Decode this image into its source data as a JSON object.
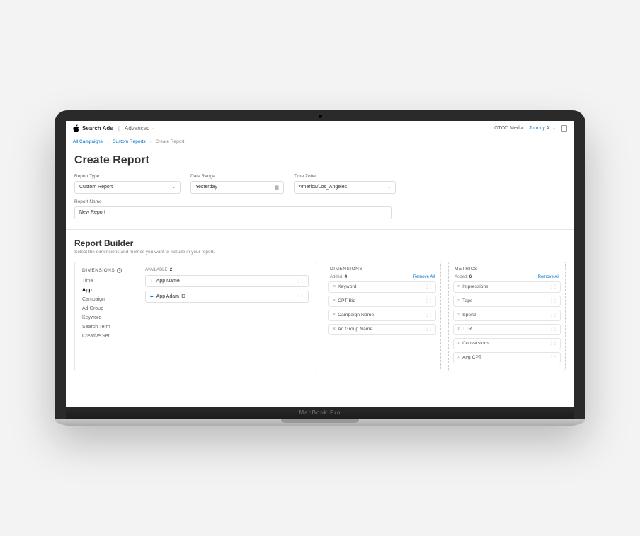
{
  "header": {
    "brand_app": "Search Ads",
    "brand_tier": "Advanced",
    "org": "OTOD Media",
    "user": "Johnny A."
  },
  "breadcrumbs": {
    "items": [
      "All Campaigns",
      "Custom Reports",
      "Create Report"
    ]
  },
  "page": {
    "title": "Create Report"
  },
  "form": {
    "report_type": {
      "label": "Report Type",
      "value": "Custom Report"
    },
    "date_range": {
      "label": "Date Range",
      "value": "Yesterday"
    },
    "time_zone": {
      "label": "Time Zone",
      "value": "America/Los_Angeles"
    },
    "report_name": {
      "label": "Report Name",
      "value": "New Report"
    }
  },
  "builder": {
    "title": "Report Builder",
    "subtitle": "Select the dimensions and metrics you want to include in your report.",
    "dimensions_label": "Dimensions",
    "categories": [
      "Time",
      "App",
      "Campaign",
      "Ad Group",
      "Keyword",
      "Search Term",
      "Creative Set"
    ],
    "active_category": "App",
    "available_label": "Available:",
    "available_count": "2",
    "available": [
      "App Name",
      "App Adam ID"
    ],
    "drop_dimensions": {
      "title": "Dimensions",
      "added_label": "Added:",
      "count": "4",
      "remove_all": "Remove All",
      "items": [
        "Keyword",
        "CPT Bid",
        "Campaign Name",
        "Ad Group Name"
      ]
    },
    "drop_metrics": {
      "title": "Metrics",
      "added_label": "Added:",
      "count": "6",
      "remove_all": "Remove All",
      "items": [
        "Impressions",
        "Taps",
        "Spend",
        "TTR",
        "Conversions",
        "Avg CPT"
      ]
    }
  },
  "laptop_label": "MacBook Pro"
}
